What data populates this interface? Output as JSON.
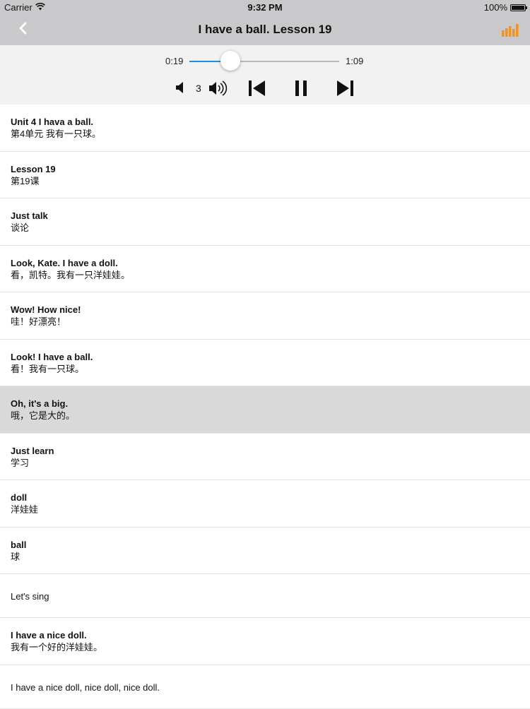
{
  "status_bar": {
    "carrier": "Carrier",
    "time": "9:32 PM",
    "battery": "100%"
  },
  "nav": {
    "title": "I have a ball. Lesson 19",
    "back_icon": "chevron-left-icon",
    "right_icon": "sound-levels-icon",
    "accent_color": "#f0931f"
  },
  "player": {
    "current_time": "0:19",
    "total_time": "1:09",
    "progress_fraction": 0.275,
    "volume": "3",
    "progress_color": "#1a8fe3"
  },
  "sentences": [
    {
      "en": "Unit 4 I hava a ball.",
      "zh": "第4单元 我有一只球。",
      "selected": false
    },
    {
      "en": "Lesson 19",
      "zh": "第19课",
      "selected": false
    },
    {
      "en": "Just talk",
      "zh": "谈论",
      "selected": false
    },
    {
      "en": "Look, Kate. I have a doll.",
      "zh": "看，凯特。我有一只洋娃娃。",
      "selected": false
    },
    {
      "en": "Wow! How nice!",
      "zh": "哇！好漂亮！",
      "selected": false
    },
    {
      "en": "Look! I have a ball.",
      "zh": "看！我有一只球。",
      "selected": false
    },
    {
      "en": "Oh, it's a big.",
      "zh": "哦，它是大的。",
      "selected": true
    },
    {
      "en": "Just learn",
      "zh": "学习",
      "selected": false
    },
    {
      "en": "doll",
      "zh": "洋娃娃",
      "selected": false
    },
    {
      "en": "ball",
      "zh": "球",
      "selected": false
    },
    {
      "en": "Let's sing",
      "zh": "",
      "selected": false
    },
    {
      "en": "I have a nice doll.",
      "zh": "我有一个好的洋娃娃。",
      "selected": false
    },
    {
      "en": "I have a nice doll, nice doll, nice doll.",
      "zh": "",
      "selected": false
    }
  ]
}
